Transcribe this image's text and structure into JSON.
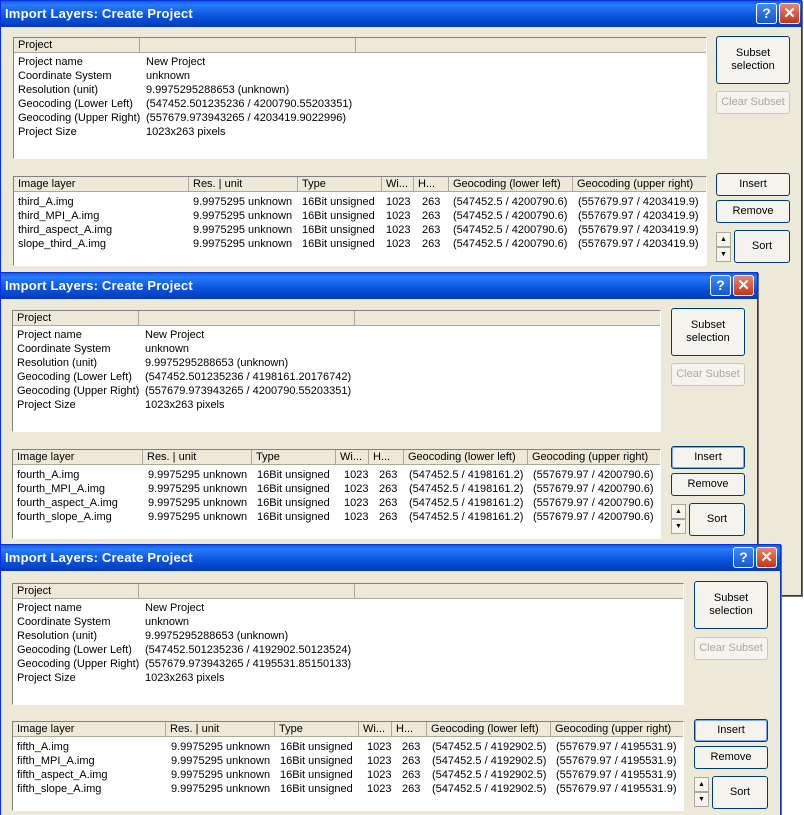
{
  "windows": [
    {
      "title": "Import Layers: Create Project",
      "help_label": "?",
      "close_label": "✕",
      "project": {
        "header": "Project",
        "rows": [
          {
            "label": "Project name",
            "value": "New Project"
          },
          {
            "label": "Coordinate System",
            "value": "unknown"
          },
          {
            "label": "Resolution (unit)",
            "value": "9.9975295288653 (unknown)"
          },
          {
            "label": "Geocoding (Lower Left)",
            "value": "(547452.501235236 / 4200790.55203351)"
          },
          {
            "label": "Geocoding (Upper Right)",
            "value": "(557679.973943265 / 4203419.9022996)"
          },
          {
            "label": "Project Size",
            "value": "1023x263 pixels"
          }
        ]
      },
      "buttons": {
        "subset": "Subset selection",
        "clear": "Clear Subset",
        "insert": "Insert",
        "remove": "Remove",
        "sort": "Sort"
      },
      "layers": {
        "columns": [
          "Image layer",
          "Res. | unit",
          "Type",
          "Wi...",
          "H...",
          "Geocoding (lower left)",
          "Geocoding (upper right)"
        ],
        "rows": [
          [
            "third_A.img",
            "9.9975295 unknown",
            "16Bit unsigned",
            "1023",
            "263",
            "(547452.5 / 4200790.6)",
            "(557679.97 / 4203419.9)"
          ],
          [
            "third_MPI_A.img",
            "9.9975295 unknown",
            "16Bit unsigned",
            "1023",
            "263",
            "(547452.5 / 4200790.6)",
            "(557679.97 / 4203419.9)"
          ],
          [
            "third_aspect_A.img",
            "9.9975295 unknown",
            "16Bit unsigned",
            "1023",
            "263",
            "(547452.5 / 4200790.6)",
            "(557679.97 / 4203419.9)"
          ],
          [
            "slope_third_A.img",
            "9.9975295 unknown",
            "16Bit unsigned",
            "1023",
            "263",
            "(547452.5 / 4200790.6)",
            "(557679.97 / 4203419.9)"
          ]
        ]
      }
    },
    {
      "title": "Import Layers: Create Project",
      "help_label": "?",
      "close_label": "✕",
      "project": {
        "header": "Project",
        "rows": [
          {
            "label": "Project name",
            "value": "New Project"
          },
          {
            "label": "Coordinate System",
            "value": "unknown"
          },
          {
            "label": "Resolution (unit)",
            "value": "9.9975295288653 (unknown)"
          },
          {
            "label": "Geocoding (Lower Left)",
            "value": "(547452.501235236 / 4198161.20176742)"
          },
          {
            "label": "Geocoding (Upper Right)",
            "value": "(557679.973943265 / 4200790.55203351)"
          },
          {
            "label": "Project Size",
            "value": "1023x263 pixels"
          }
        ]
      },
      "buttons": {
        "subset": "Subset selection",
        "clear": "Clear Subset",
        "insert": "Insert",
        "remove": "Remove",
        "sort": "Sort"
      },
      "layers": {
        "columns": [
          "Image layer",
          "Res. | unit",
          "Type",
          "Wi...",
          "H...",
          "Geocoding (lower left)",
          "Geocoding (upper right)"
        ],
        "rows": [
          [
            "fourth_A.img",
            "9.9975295 unknown",
            "16Bit unsigned",
            "1023",
            "263",
            "(547452.5 / 4198161.2)",
            "(557679.97 / 4200790.6)"
          ],
          [
            "fourth_MPI_A.img",
            "9.9975295 unknown",
            "16Bit unsigned",
            "1023",
            "263",
            "(547452.5 / 4198161.2)",
            "(557679.97 / 4200790.6)"
          ],
          [
            "fourth_aspect_A.img",
            "9.9975295 unknown",
            "16Bit unsigned",
            "1023",
            "263",
            "(547452.5 / 4198161.2)",
            "(557679.97 / 4200790.6)"
          ],
          [
            "fourth_slope_A.img",
            "9.9975295 unknown",
            "16Bit unsigned",
            "1023",
            "263",
            "(547452.5 / 4198161.2)",
            "(557679.97 / 4200790.6)"
          ]
        ]
      }
    },
    {
      "title": "Import Layers: Create Project",
      "help_label": "?",
      "close_label": "✕",
      "project": {
        "header": "Project",
        "rows": [
          {
            "label": "Project name",
            "value": "New Project"
          },
          {
            "label": "Coordinate System",
            "value": "unknown"
          },
          {
            "label": "Resolution (unit)",
            "value": "9.9975295288653 (unknown)"
          },
          {
            "label": "Geocoding (Lower Left)",
            "value": "(547452.501235236 / 4192902.50123524)"
          },
          {
            "label": "Geocoding (Upper Right)",
            "value": "(557679.973943265 / 4195531.85150133)"
          },
          {
            "label": "Project Size",
            "value": "1023x263 pixels"
          }
        ]
      },
      "buttons": {
        "subset": "Subset selection",
        "clear": "Clear Subset",
        "insert": "Insert",
        "remove": "Remove",
        "sort": "Sort"
      },
      "layers": {
        "columns": [
          "Image layer",
          "Res. | unit",
          "Type",
          "Wi...",
          "H...",
          "Geocoding (lower left)",
          "Geocoding (upper right)"
        ],
        "rows": [
          [
            "fifth_A.img",
            "9.9975295 unknown",
            "16Bit unsigned",
            "1023",
            "263",
            "(547452.5 / 4192902.5)",
            "(557679.97 / 4195531.9)"
          ],
          [
            "fifth_MPI_A.img",
            "9.9975295 unknown",
            "16Bit unsigned",
            "1023",
            "263",
            "(547452.5 / 4192902.5)",
            "(557679.97 / 4195531.9)"
          ],
          [
            "fifth_aspect_A.img",
            "9.9975295 unknown",
            "16Bit unsigned",
            "1023",
            "263",
            "(547452.5 / 4192902.5)",
            "(557679.97 / 4195531.9)"
          ],
          [
            "fifth_slope_A.img",
            "9.9975295 unknown",
            "16Bit unsigned",
            "1023",
            "263",
            "(547452.5 / 4192902.5)",
            "(557679.97 / 4195531.9)"
          ]
        ]
      }
    }
  ]
}
